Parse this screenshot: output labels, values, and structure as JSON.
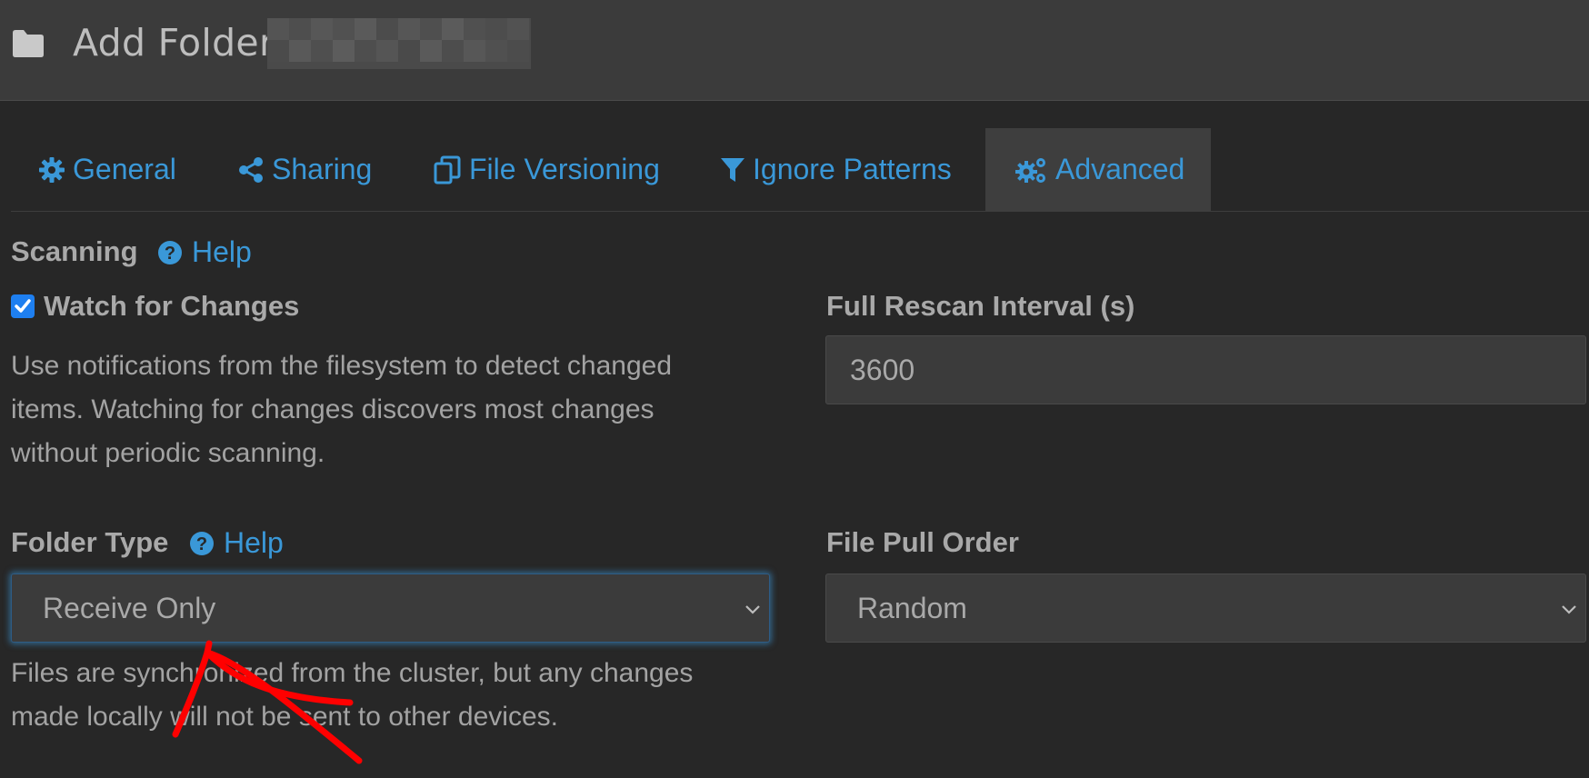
{
  "header": {
    "title": "Add Folder",
    "icon": "folder-icon"
  },
  "tabs": [
    {
      "label": "General",
      "icon": "gear-icon"
    },
    {
      "label": "Sharing",
      "icon": "share-icon"
    },
    {
      "label": "File Versioning",
      "icon": "copy-icon"
    },
    {
      "label": "Ignore Patterns",
      "icon": "filter-icon"
    },
    {
      "label": "Advanced",
      "icon": "gears-icon"
    }
  ],
  "active_tab": "Advanced",
  "scanning": {
    "title": "Scanning",
    "help": "Help",
    "watch_label": "Watch for Changes",
    "watch_checked": true,
    "watch_help_lines": [
      "Use notifications from the filesystem to detect changed",
      "items. Watching for changes discovers most changes",
      "without periodic scanning."
    ],
    "rescan_label": "Full Rescan Interval (s)",
    "rescan_value": "3600"
  },
  "folder_type": {
    "title": "Folder Type",
    "help": "Help",
    "value": "Receive Only",
    "help_lines": [
      "Files are synchronized from the cluster, but any changes",
      "made locally will not be sent to other devices."
    ]
  },
  "pull_order": {
    "label": "File Pull Order",
    "value": "Random"
  },
  "colors": {
    "accent": "#3a98d8",
    "background": "#272727",
    "header": "#3b3b3b",
    "annotation": "#ff0000"
  }
}
